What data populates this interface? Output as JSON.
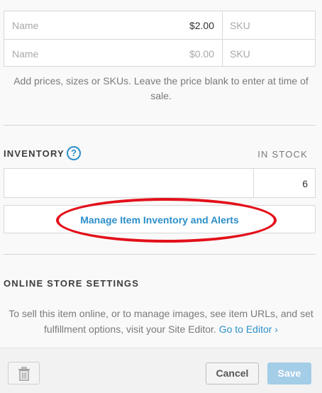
{
  "variants": [
    {
      "name_placeholder": "Name",
      "price": "$2.00",
      "price_is_placeholder": false,
      "sku_placeholder": "SKU"
    },
    {
      "name_placeholder": "Name",
      "price": "$0.00",
      "price_is_placeholder": true,
      "sku_placeholder": "SKU"
    }
  ],
  "help_text": "Add prices, sizes or SKUs. Leave the price blank to enter at time of sale.",
  "inventory": {
    "title": "INVENTORY",
    "help_icon": "?",
    "in_stock_label": "IN STOCK",
    "quantity": "6",
    "manage_button_label": "Manage Item Inventory and Alerts",
    "highlight_color": "#e3101a"
  },
  "online_store": {
    "title": "ONLINE STORE SETTINGS",
    "text": "To sell this item online, or to manage images, see item URLs, and set fulfillment options, visit your Site Editor.",
    "link_label": "Go to Editor",
    "link_icon": "chevron-right-icon"
  },
  "footer": {
    "delete_icon": "trash-icon",
    "cancel_label": "Cancel",
    "save_label": "Save"
  },
  "colors": {
    "accent": "#2d8fc9",
    "save_disabled": "#a4cde8"
  }
}
